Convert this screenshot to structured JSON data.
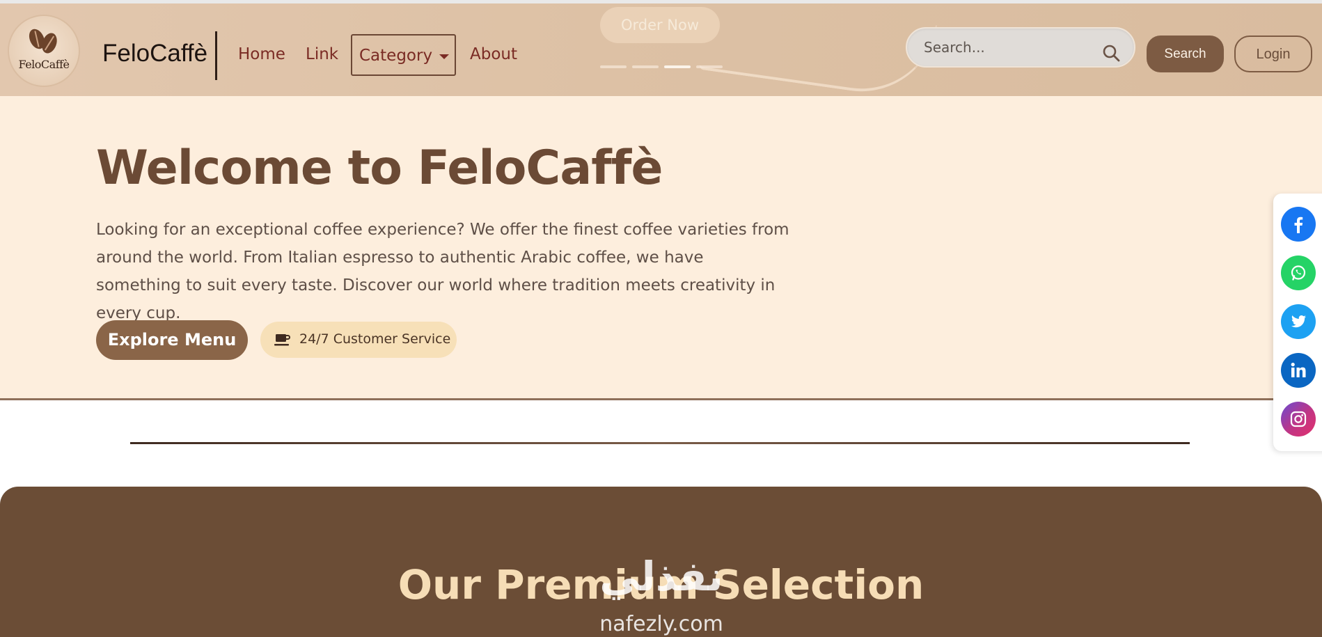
{
  "nav": {
    "logo_text": "FeloCaffè",
    "brand": "FeloCaffè",
    "links": {
      "home": "Home",
      "link": "Link",
      "category": "Category",
      "about": "About"
    },
    "order_button": "Order Now",
    "carousel_indicators_total": 4,
    "carousel_active_index": 3,
    "search": {
      "placeholder": "Search...",
      "button_label": "Search"
    },
    "login": "Login"
  },
  "hero": {
    "title": "Welcome to FeloCaffè",
    "description": "Looking for an exceptional coffee experience? We offer the finest coffee varieties from around the world. From Italian espresso to authentic Arabic coffee, we have something to suit every taste. Discover our world where tradition meets creativity in every cup.",
    "explore_button": "Explore Menu",
    "service_badge": "24/7 Customer Service"
  },
  "premium": {
    "title": "Our Premium Selection"
  },
  "watermark": {
    "arabic": "نفذلي",
    "domain": "nafezly.com"
  },
  "social": [
    {
      "name": "facebook",
      "color": "#1877f2"
    },
    {
      "name": "whatsapp",
      "color": "#25d366"
    },
    {
      "name": "twitter",
      "color": "#1da1f2"
    },
    {
      "name": "linkedin",
      "color": "#0a66c2"
    },
    {
      "name": "instagram",
      "color": "#c13584"
    }
  ],
  "colors": {
    "brand_brown": "#6b4a35",
    "button_brown": "#8a6548",
    "hero_bg": "#fdeedd",
    "premium_bg": "#6b4d36"
  }
}
